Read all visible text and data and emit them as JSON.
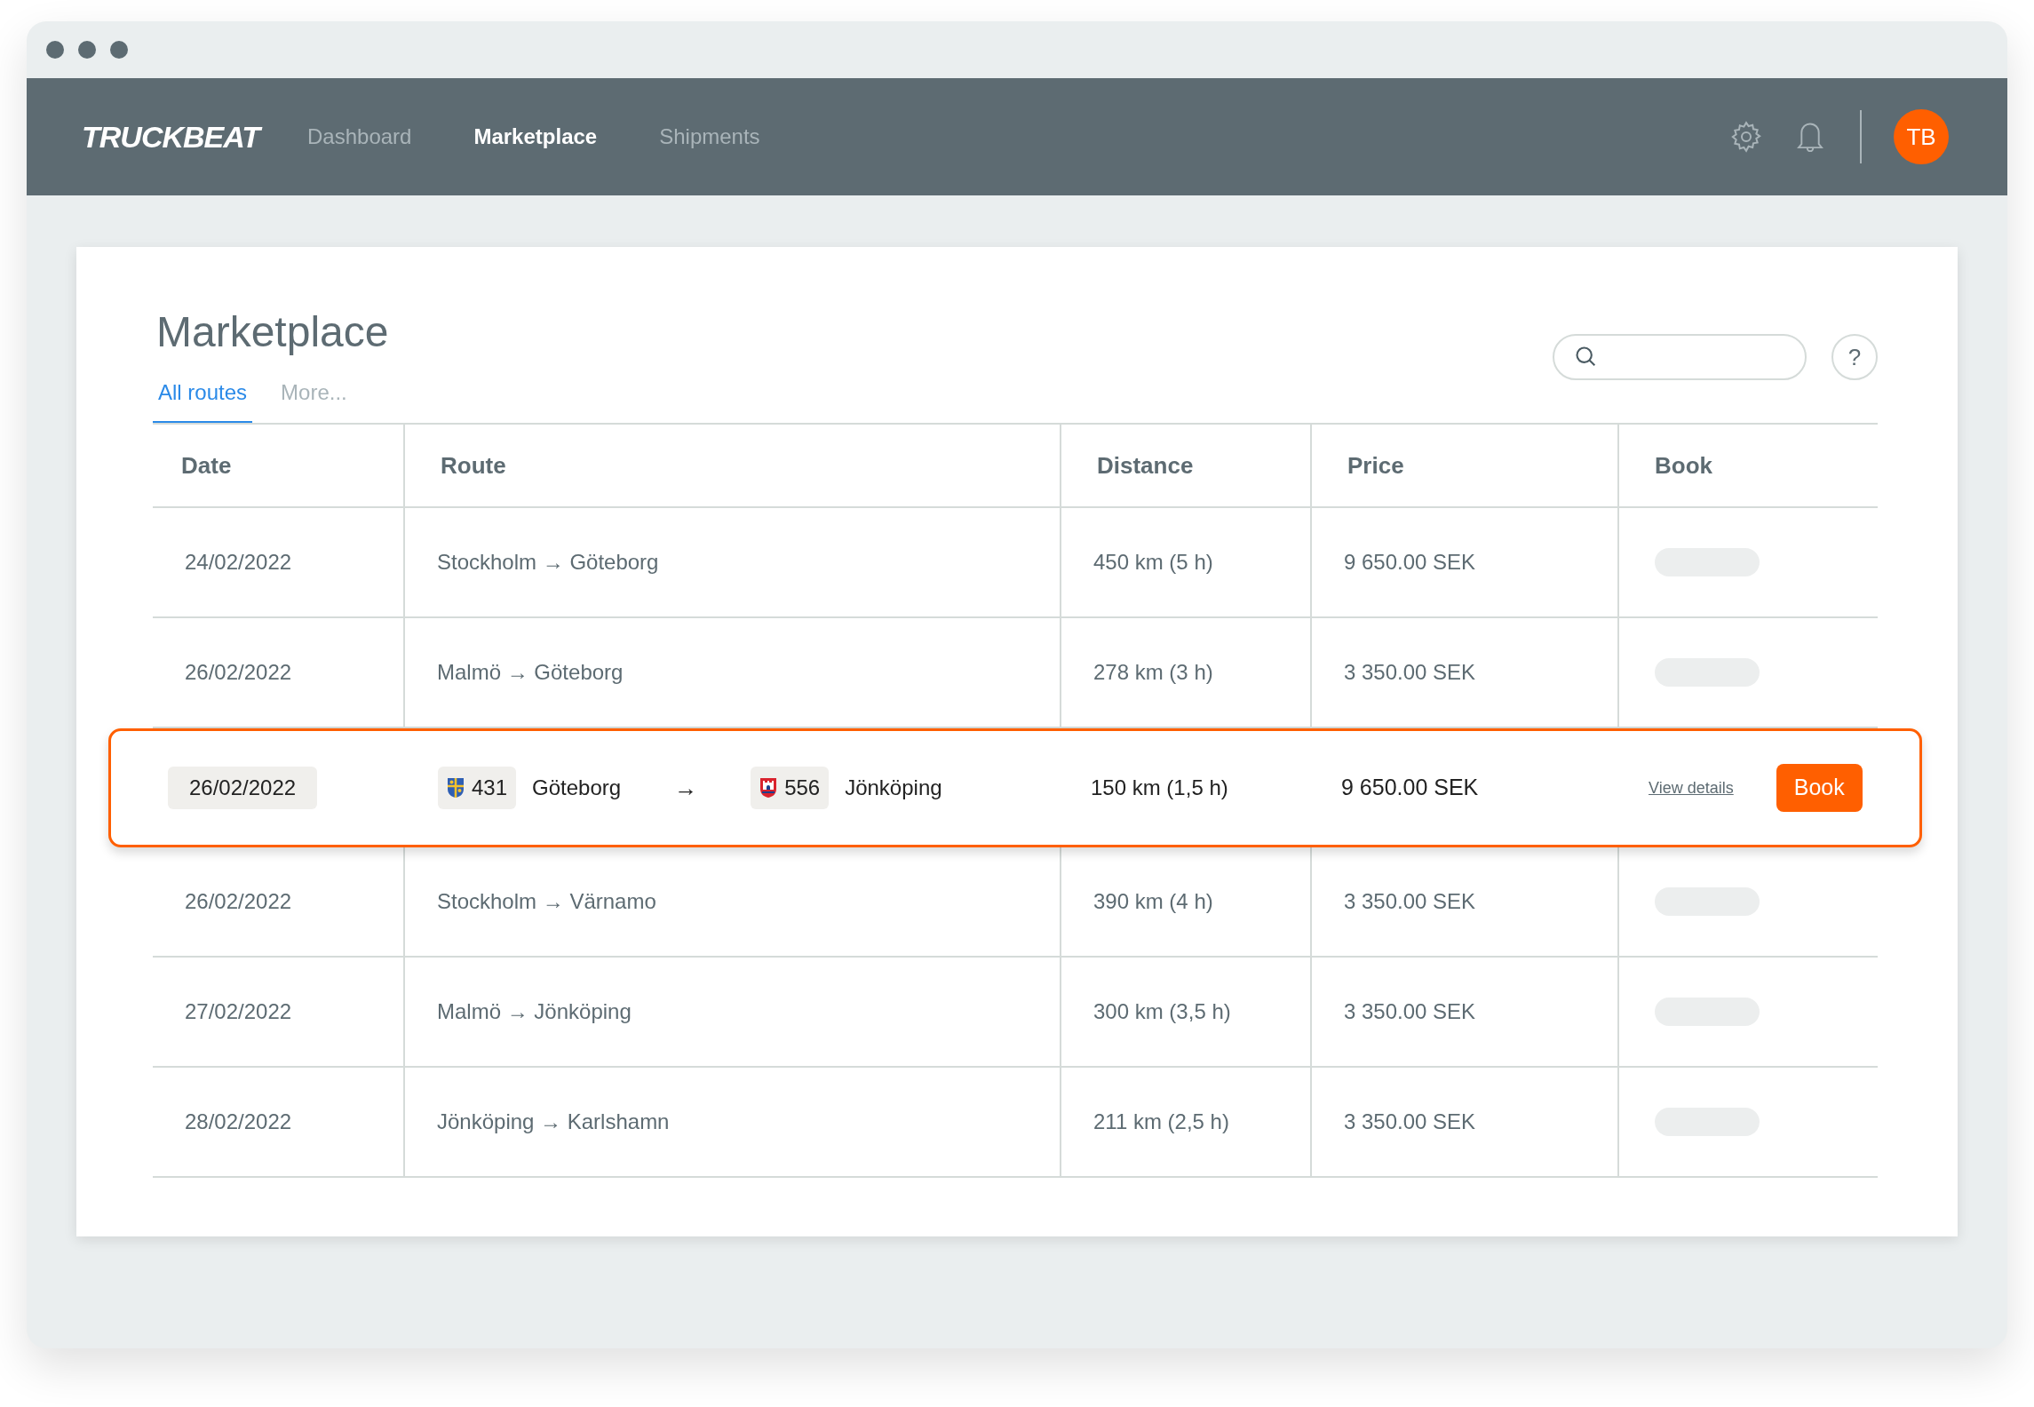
{
  "nav": {
    "logo": "TRUCKBEAT",
    "links": [
      {
        "label": "Dashboard",
        "selected": false
      },
      {
        "label": "Marketplace",
        "selected": true
      },
      {
        "label": "Shipments",
        "selected": false
      }
    ],
    "avatar": "TB"
  },
  "page": {
    "title": "Marketplace",
    "tabs": [
      {
        "label": "All routes",
        "selected": true
      },
      {
        "label": "More...",
        "selected": false
      }
    ],
    "help": "?"
  },
  "table": {
    "columns": [
      "Date",
      "Route",
      "Distance",
      "Price",
      "Book"
    ],
    "rows": [
      {
        "selected": false,
        "date": "24/02/2022",
        "route": "Stockholm → Göteborg",
        "distance": "450 km (5 h)",
        "price": "9 650.00 SEK"
      },
      {
        "selected": false,
        "date": "26/02/2022",
        "route": "Malmö → Göteborg",
        "distance": "278 km (3 h)",
        "price": "3 350.00 SEK"
      },
      {
        "selected": true,
        "date": "26/02/2022",
        "from": {
          "code": "431",
          "name": "Göteborg"
        },
        "arrow": "→",
        "to": {
          "code": "556",
          "name": "Jönköping"
        },
        "distance": "150 km (1,5 h)",
        "price": "9 650.00 SEK",
        "link": "View details",
        "button": "Book"
      },
      {
        "selected": false,
        "date": "26/02/2022",
        "route": "Stockholm → Värnamo",
        "distance": "390 km (4 h)",
        "price": "3 350.00 SEK"
      },
      {
        "selected": false,
        "date": "27/02/2022",
        "route": "Malmö → Jönköping",
        "distance": "300 km (3,5 h)",
        "price": "3 350.00 SEK"
      },
      {
        "selected": false,
        "date": "28/02/2022",
        "route": "Jönköping → Karlshamn",
        "distance": "211 km (2,5 h)",
        "price": "3 350.00 SEK"
      }
    ]
  }
}
